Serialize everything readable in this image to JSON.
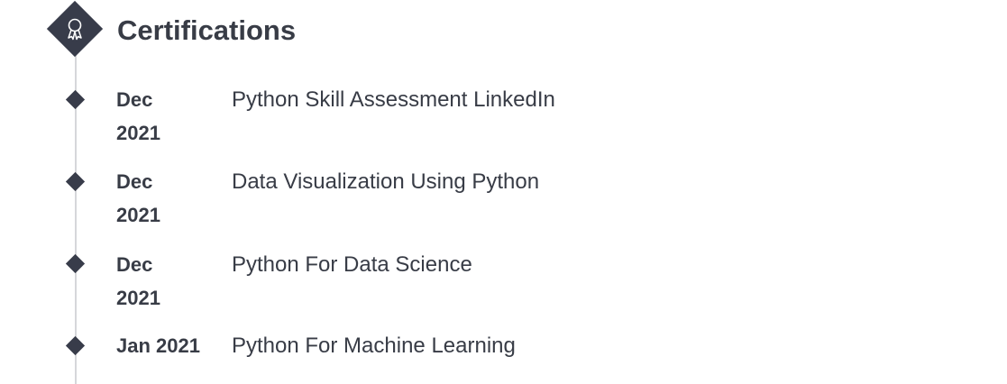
{
  "section": {
    "title": "Certifications",
    "icon": "award-ribbon-icon"
  },
  "colors": {
    "accent": "#383c4a",
    "text": "#383c46",
    "line": "#d6d7da"
  },
  "certifications": [
    {
      "date": "Dec 2021",
      "name": "Python Skill Assessment LinkedIn"
    },
    {
      "date": "Dec 2021",
      "name": "Data Visualization Using Python"
    },
    {
      "date": "Dec 2021",
      "name": "Python For Data Science"
    },
    {
      "date": "Jan 2021",
      "name": "Python For Machine Learning"
    }
  ]
}
